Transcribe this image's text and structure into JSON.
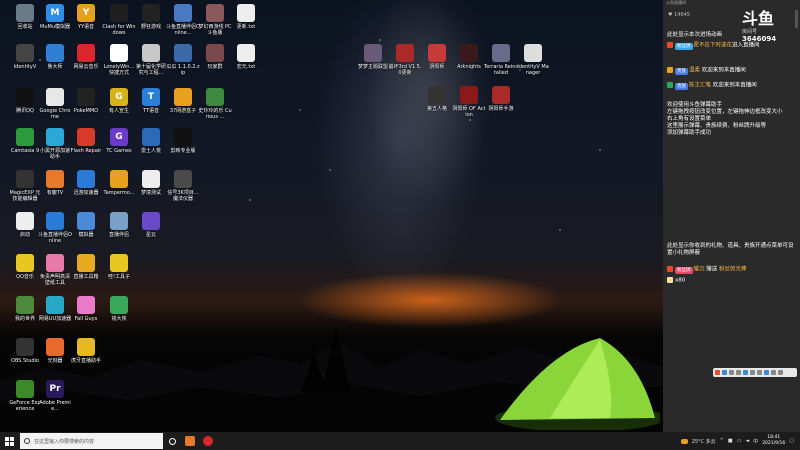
{
  "desktop": {
    "icons": [
      {
        "label": "回收站",
        "color": "#6a7a88",
        "glyph": ""
      },
      {
        "label": "MuMu模拟器",
        "color": "#2d8ee8",
        "glyph": "M"
      },
      {
        "label": "YY语音",
        "color": "#e6a020",
        "glyph": "Y"
      },
      {
        "label": "Clash for Windows",
        "color": "#1f1f1f",
        "glyph": ""
      },
      {
        "label": "野狂游戏",
        "color": "#222222",
        "glyph": ""
      },
      {
        "label": "斗鱼直播伴侣Online...",
        "color": "#4a79c4",
        "glyph": ""
      },
      {
        "label": "梦幻西游线 PC 斗鱼版",
        "color": "#8a5a5a",
        "glyph": ""
      },
      {
        "label": "更新.txt",
        "color": "#eeeeee",
        "glyph": ""
      },
      {
        "label": "IdentityV",
        "color": "#444444",
        "glyph": ""
      },
      {
        "label": "鲁大师",
        "color": "#2f7fd6",
        "glyph": ""
      },
      {
        "label": "网易云音乐",
        "color": "#d8272d",
        "glyph": ""
      },
      {
        "label": "LonelyWin...快捷方式",
        "color": "#ffffff",
        "glyph": ""
      },
      {
        "label": "第十届化学研究与工程...",
        "color": "#c8c8c8",
        "glyph": ""
      },
      {
        "label": "瓜瓜 1.1.0.2.zip",
        "color": "#3a6aa8",
        "glyph": ""
      },
      {
        "label": "玩家群",
        "color": "#7a4a4a",
        "glyph": ""
      },
      {
        "label": "宏元.txt",
        "color": "#eeeeee",
        "glyph": ""
      },
      {
        "label": "腾讯QQ",
        "color": "#111111",
        "glyph": ""
      },
      {
        "label": "Google Chrome",
        "color": "#e8e8e8",
        "glyph": ""
      },
      {
        "label": "PokeMMO",
        "color": "#222222",
        "glyph": ""
      },
      {
        "label": "有人宣生",
        "color": "#d6b318",
        "glyph": "G"
      },
      {
        "label": "TT语音",
        "color": "#2a7fd8",
        "glyph": "T"
      },
      {
        "label": "37网游盒子",
        "color": "#e8a020",
        "glyph": ""
      },
      {
        "label": "史玲玲的乐 Curious ...",
        "color": "#3e8a3e",
        "glyph": ""
      },
      {
        "label": "Camtasia 9",
        "color": "#2e9a3e",
        "glyph": ""
      },
      {
        "label": "小黑开源加速助手",
        "color": "#2aa8d8",
        "glyph": ""
      },
      {
        "label": "Flash Repair",
        "color": "#d83a2a",
        "glyph": ""
      },
      {
        "label": "TC Games",
        "color": "#6a3ac8",
        "glyph": "G"
      },
      {
        "label": "雷土人荒",
        "color": "#2a6ab8",
        "glyph": ""
      },
      {
        "label": "剪映专业版",
        "color": "#111111",
        "glyph": ""
      },
      {
        "label": "MagicEXP 元技能编辑器",
        "color": "#333333",
        "glyph": ""
      },
      {
        "label": "有鹿TV",
        "color": "#e8782a",
        "glyph": ""
      },
      {
        "label": "迅游加速器",
        "color": "#2a7ad8",
        "glyph": ""
      },
      {
        "label": "Tampermo...",
        "color": "#e8a020",
        "glyph": ""
      },
      {
        "label": "梦境测试",
        "color": "#eeeeee",
        "glyph": ""
      },
      {
        "label": "信号3K项目...魔法仪器",
        "color": "#4a4a4a",
        "glyph": ""
      },
      {
        "label": "启动",
        "color": "#eeeeee",
        "glyph": ""
      },
      {
        "label": "斗鱼直播伴侣Online",
        "color": "#2a7ad8",
        "glyph": ""
      },
      {
        "label": "模拟器",
        "color": "#4a8ad8",
        "glyph": ""
      },
      {
        "label": "直播伴侣",
        "color": "#7aa0c8",
        "glyph": ""
      },
      {
        "label": "星云",
        "color": "#6a4ac8",
        "glyph": ""
      },
      {
        "label": "QQ音乐",
        "color": "#e8c820",
        "glyph": ""
      },
      {
        "label": "免责声明高清壁纸工具",
        "color": "#e87aa8",
        "glyph": ""
      },
      {
        "label": "直播工具箱",
        "color": "#e8a820",
        "glyph": ""
      },
      {
        "label": "哇!工具子",
        "color": "#e8c820",
        "glyph": ""
      },
      {
        "label": "我的世界",
        "color": "#4a8a3a",
        "glyph": ""
      },
      {
        "label": "网易UU加速器",
        "color": "#2aa8c8",
        "glyph": ""
      },
      {
        "label": "Fall Guys",
        "color": "#e87ac8",
        "glyph": ""
      },
      {
        "label": "钱大侠",
        "color": "#3aa85a",
        "glyph": ""
      },
      {
        "label": "OBS Studio",
        "color": "#333333",
        "glyph": ""
      },
      {
        "label": "光刻器",
        "color": "#e86a2a",
        "glyph": ""
      },
      {
        "label": "虎牙直播助手",
        "color": "#e8b820",
        "glyph": ""
      },
      {
        "label": "GeForce Experience",
        "color": "#3a8a2a",
        "glyph": ""
      },
      {
        "label": "Adobe Premie...",
        "color": "#2a1a5a",
        "glyph": "Pr"
      },
      {
        "label": "梦梦主题联盟",
        "color": "#6a5a7a",
        "glyph": ""
      },
      {
        "label": "崩坏3rd V1.5.0更新",
        "color": "#aa2a2a",
        "glyph": ""
      },
      {
        "label": "阴阳师",
        "color": "#c83a3a",
        "glyph": ""
      },
      {
        "label": "Arknights",
        "color": "#3a1a1a",
        "glyph": ""
      },
      {
        "label": "Terraria Reinstalled",
        "color": "#6a6a8a",
        "glyph": ""
      },
      {
        "label": "IdentityV Manager",
        "color": "#dddddd",
        "glyph": ""
      },
      {
        "label": "第五人格",
        "color": "#333333",
        "glyph": ""
      },
      {
        "label": "阴阳师 OF Action",
        "color": "#8a1a1a",
        "glyph": ""
      },
      {
        "label": "阴阳师手游",
        "color": "#aa2a2a",
        "glyph": ""
      }
    ]
  },
  "taskbar": {
    "search_placeholder": "在这里输入你要搜索的内容",
    "weather": "25°C 多云",
    "time": "18:41",
    "date": "2021/9/16"
  },
  "panel": {
    "header": "斗鱼直播间",
    "fans_count": "14645",
    "douyu_logo": "斗鱼",
    "room_label": "房间号",
    "room_number": "3646094",
    "lines_top": [
      {
        "text": "此处显示本次进场动画"
      },
      {
        "badge": "粉丝牌",
        "user": "愿不在下时逢花",
        "text": "进入直播间"
      },
      {
        "badge": "贵族",
        "user": "温柔",
        "text": "欢迎来到本直播间"
      },
      {
        "badge": "贵族",
        "user": "陈主汇笔",
        "text": "欢迎来到本直播间"
      }
    ],
    "notice": "欢迎使用斗鱼弹幕助手\n左键拖拽按钮改变位置，左键拖伸边框改变大小\n右上角有设置菜单\n这里展示弹幕、贵族续费、粉丝牌升级等\n添加弹幕助手成功",
    "gift_info": "此处显示你收到的礼物、道具、贵族开通点菜单可设置小礼物屏蔽",
    "gift_line": {
      "badge": "粉丝牌",
      "user": "耀沉",
      "text": "赠送",
      "gift": "粉丝荧光棒",
      "count": "x80"
    }
  }
}
